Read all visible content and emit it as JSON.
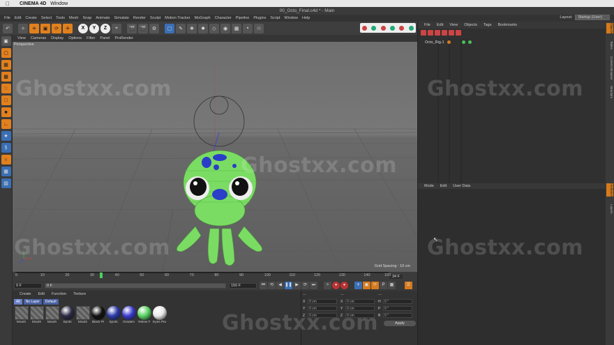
{
  "mac_menu": {
    "app": "CINEMA 4D",
    "window": "Window"
  },
  "title": "00_Octo_Final.c4d * - Main",
  "menubar": [
    "File",
    "Edit",
    "Create",
    "Select",
    "Tools",
    "Mesh",
    "Snap",
    "Animate",
    "Simulate",
    "Render",
    "Sculpt",
    "Motion Tracker",
    "MoGraph",
    "Character",
    "Pipeline",
    "Plugins",
    "Script",
    "Window",
    "Help"
  ],
  "layout": {
    "label": "Layout:",
    "value": "Startup (User)"
  },
  "toolbar": {
    "left_icons": [
      "undo-icon",
      "select-icon",
      "move-icon",
      "scale-icon",
      "rotate-icon"
    ],
    "axes": [
      "X",
      "Y",
      "Z"
    ]
  },
  "viewport_menu": [
    "View",
    "Cameras",
    "Display",
    "Options",
    "Filter",
    "Panel",
    "ProRender"
  ],
  "viewport": {
    "label": "Perspective",
    "grid_spacing": "Grid Spacing : 10 cm"
  },
  "timeline": {
    "ticks": [
      "0",
      "10",
      "20",
      "30",
      "40",
      "50",
      "60",
      "70",
      "80",
      "90",
      "100",
      "110",
      "120",
      "130",
      "140",
      "150"
    ],
    "current_frame": "34 F",
    "playhead_fraction": 0.227
  },
  "transport": {
    "start": "0 F",
    "slider": "0 F",
    "end": "150 F",
    "end2": "150 F"
  },
  "material_menu": [
    "Create",
    "Edit",
    "Function",
    "Texture"
  ],
  "material_filters": [
    "All",
    "No Layer",
    "Default"
  ],
  "materials": [
    {
      "name": "Mouth",
      "kind": "stripe"
    },
    {
      "name": "Mouth",
      "kind": "stripe"
    },
    {
      "name": "Mouth",
      "kind": "stripe"
    },
    {
      "name": "Spots",
      "kind": "sphere",
      "color": "#2a2a44"
    },
    {
      "name": "Mouth",
      "kind": "stripe"
    },
    {
      "name": "Black Pl",
      "kind": "sphere",
      "color": "#111111"
    },
    {
      "name": "Spots",
      "kind": "sphere",
      "color": "#2a3aa8"
    },
    {
      "name": "Gradien",
      "kind": "sphere",
      "color": "#3a3acc"
    },
    {
      "name": "Yellow F",
      "kind": "sphere",
      "color": "#58d163"
    },
    {
      "name": "Eyes Pla",
      "kind": "sphere",
      "color": "#e8e8e8"
    }
  ],
  "coords": {
    "rows": [
      [
        {
          "axis": "X",
          "value": "0 cm"
        },
        {
          "axis": "X",
          "value": "0 cm"
        },
        {
          "axis": "H",
          "value": "0 °"
        }
      ],
      [
        {
          "axis": "Y",
          "value": "0 cm"
        },
        {
          "axis": "Y",
          "value": "0 cm"
        },
        {
          "axis": "P",
          "value": "0 °"
        }
      ],
      [
        {
          "axis": "Z",
          "value": "0 cm"
        },
        {
          "axis": "Z",
          "value": "0 cm"
        },
        {
          "axis": "B",
          "value": "0 °"
        }
      ]
    ],
    "headers": [
      "---",
      "---",
      "---"
    ],
    "apply": "Apply"
  },
  "object_menu": [
    "File",
    "Edit",
    "View",
    "Objects",
    "Tags",
    "Bookmarks"
  ],
  "object": {
    "name": "Octo_Rig.1"
  },
  "attributes_menu": [
    "Mode",
    "Edit",
    "User Data"
  ],
  "right_tabs": [
    "Objects",
    "Takes",
    "Content Browser",
    "Structure",
    "Attributes",
    "Layers"
  ],
  "watermark": "Ghostxx.com",
  "colors": {
    "accent": "#d77a1c",
    "octo_body": "#7bdc64",
    "spots": "#2a3ec8"
  }
}
